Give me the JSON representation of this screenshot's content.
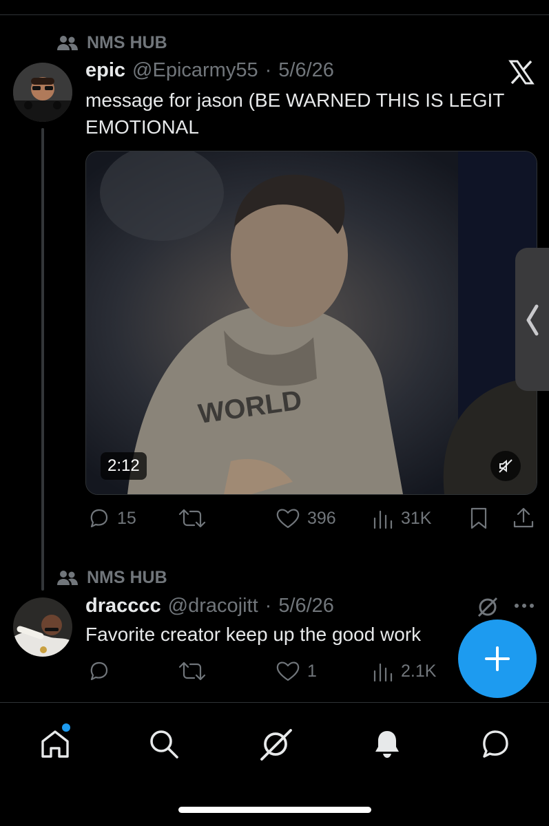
{
  "tweet1": {
    "context": "NMS HUB",
    "name": "epic",
    "handle": "@Epicarmy55",
    "sep": "·",
    "date": "5/6/26",
    "text": "message for jason (BE WARNED THIS IS LEGIT EMOTIONAL",
    "video_duration": "2:12",
    "replies": "15",
    "retweets": "",
    "likes": "396",
    "views": "31K"
  },
  "tweet2": {
    "context": "NMS HUB",
    "name": "dracccc",
    "handle": "@dracojitt",
    "sep": "·",
    "date": "5/6/26",
    "text": "Favorite creator keep up the good work",
    "replies": "",
    "retweets": "",
    "likes": "1",
    "views": "2.1K"
  },
  "colors": {
    "accent": "#1d9bf0",
    "muted": "#71767b",
    "text": "#e7e9ea",
    "background": "#000000"
  },
  "icons": [
    "people-icon",
    "x-logo-icon",
    "reply-icon",
    "retweet-icon",
    "like-icon",
    "views-icon",
    "bookmark-icon",
    "share-icon",
    "mute-icon",
    "grok-icon",
    "more-icon",
    "compose-icon",
    "home-icon",
    "search-icon",
    "notifications-icon",
    "messages-icon",
    "chevron-left-icon"
  ]
}
